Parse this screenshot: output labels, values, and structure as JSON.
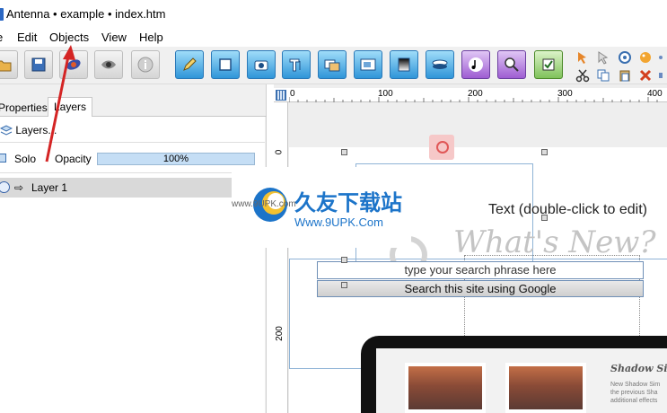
{
  "window": {
    "title": "Antenna • example • index.htm"
  },
  "menu": {
    "items": [
      "e",
      "Edit",
      "Objects",
      "View",
      "Help"
    ]
  },
  "panel": {
    "tabs": [
      "Properties",
      "Layers"
    ],
    "active_tab": "Layers",
    "layers_link": "Layers...",
    "solo_label": "Solo",
    "opacity_label": "Opacity",
    "opacity_value": "100%",
    "layers": [
      {
        "name": "Layer 1"
      }
    ]
  },
  "ruler": {
    "top_labels": [
      "0",
      "100",
      "200",
      "300",
      "400"
    ],
    "left_labels": [
      "0",
      "200"
    ]
  },
  "canvas": {
    "text_element": "Text (double-click to edit)",
    "headline": "What's New?",
    "search_placeholder": "type your search phrase here",
    "search_button": "Search this site using Google",
    "shadow_title": "Shadow Sim",
    "shadow_desc": [
      "New Shadow Sim",
      "the previous Sha",
      "additional effects"
    ]
  },
  "watermark": {
    "brand": "久友下载站",
    "url": "Www.9UPK.Com",
    "small": "www.9UPK.com"
  },
  "colors": {
    "accent": "#2f95d8",
    "watermark": "#1c74c9",
    "annotation_arrow": "#d42424"
  }
}
